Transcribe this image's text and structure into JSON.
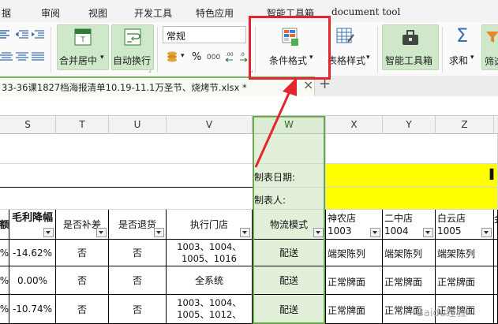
{
  "menu": [
    "据",
    "审阅",
    "视图",
    "开发工具",
    "特色应用",
    "智能工具箱",
    "document tool"
  ],
  "ribbon": {
    "merge_center": "合并居中",
    "auto_wrap": "自动换行",
    "number_format": "常规",
    "percent": "%",
    "thousands": "000",
    "conditional_format": "条件格式",
    "table_style": "表格样式",
    "smart_toolbox": "智能工具箱",
    "sum": "求和",
    "filter": "筛选"
  },
  "file_tab": {
    "name": "33-36课1827档海报清单10.19-11.1万圣节、烧烤节.xlsx *",
    "close": "×",
    "add": "+"
  },
  "columns": [
    "S",
    "T",
    "U",
    "V",
    "W",
    "X",
    "Y",
    "Z"
  ],
  "selected_column": "W",
  "info": {
    "date_label": "制表日期:",
    "maker_label": "制表人:"
  },
  "headers": {
    "r_tail": "额",
    "s": "毛利降幅",
    "t": "是否补差",
    "u": "是否退货",
    "v": "执行门店",
    "w": "物流模式",
    "x": "神农店 1003",
    "y": "二中店 1004",
    "z": "白云店 1005",
    "aa": "金"
  },
  "rows": [
    {
      "r": "%",
      "s": "-14.62%",
      "t": "否",
      "u": "否",
      "v": "1003、1004、1005、1016",
      "w": "配送",
      "x": "端架陈列",
      "y": "端架陈列",
      "z": "端架陈列"
    },
    {
      "r": "%",
      "s": "0.00%",
      "t": "否",
      "u": "否",
      "v": "全系统",
      "w": "配送",
      "x": "正常牌面",
      "y": "正常牌面",
      "z": "正常牌面"
    },
    {
      "r": "%",
      "s": "-10.74%",
      "t": "否",
      "u": "否",
      "v": "1003、1004、1005、1012、",
      "w": "配送",
      "x": "正常牌面",
      "y": "正常牌面",
      "z": "正常牌面"
    }
  ],
  "watermark": "Baidu经验",
  "colors": {
    "selection": "#6aa84f",
    "highlight_yellow": "#ffff00",
    "annotation_red": "#e3262d",
    "ribbon_active": "#cfe8c9"
  }
}
